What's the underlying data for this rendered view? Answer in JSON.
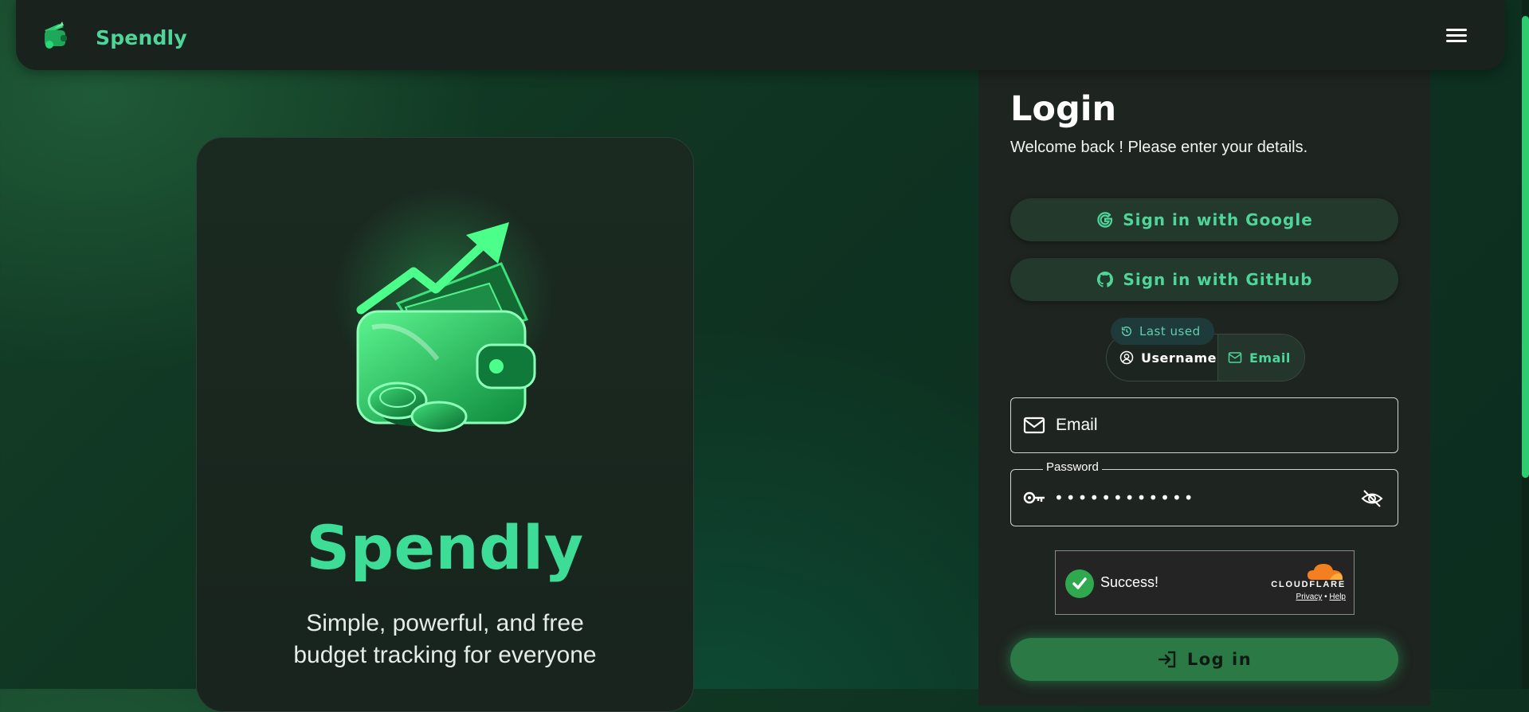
{
  "nav": {
    "brand": "Spendly",
    "logo_icon": "wallet-logo-icon",
    "menu_icon": "hamburger-menu-icon"
  },
  "hero": {
    "title": "Spendly",
    "tagline_line1": "Simple, powerful, and free",
    "tagline_line2": "budget tracking for everyone",
    "illustration": "wallet-growth-illustration"
  },
  "login": {
    "title": "Login",
    "subtitle": "Welcome back ! Please enter your details.",
    "google_label": "Sign in with Google",
    "github_label": "Sign in with GitHub",
    "last_used_label": "Last used",
    "method_username_label": "Username",
    "method_email_label": "Email",
    "email_placeholder": "Email",
    "password_label": "Password",
    "password_mask": "••••••••••••",
    "captcha_status": "Success!",
    "captcha_brand": "CLOUDFLARE",
    "captcha_privacy": "Privacy",
    "captcha_separator": "•",
    "captcha_help": "Help",
    "login_button": "Log in"
  },
  "colors": {
    "accent_green": "#4ed59a",
    "primary_button": "#2b7a45",
    "panel_bg": "#1e2420",
    "success_green": "#2fa84f",
    "cloudflare_orange": "#f38020"
  }
}
